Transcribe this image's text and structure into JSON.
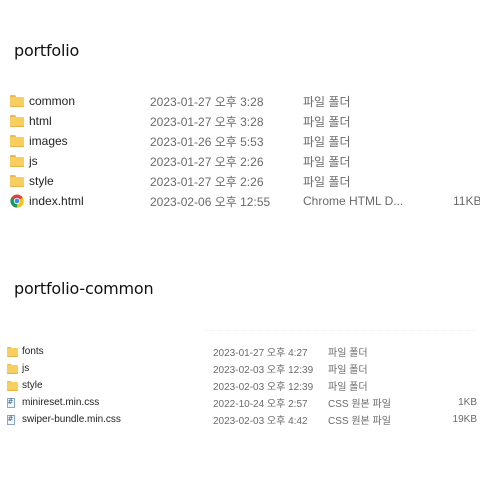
{
  "sections": [
    {
      "title": "portfolio",
      "rows": [
        {
          "icon": "folder-icon",
          "name": "common",
          "date": "2023-01-27 오후 3:28",
          "type": "파일 폴더",
          "size": ""
        },
        {
          "icon": "folder-icon",
          "name": "html",
          "date": "2023-01-27 오후 3:28",
          "type": "파일 폴더",
          "size": ""
        },
        {
          "icon": "folder-icon",
          "name": "images",
          "date": "2023-01-26 오후 5:53",
          "type": "파일 폴더",
          "size": ""
        },
        {
          "icon": "folder-icon",
          "name": "js",
          "date": "2023-01-27 오후 2:26",
          "type": "파일 폴더",
          "size": ""
        },
        {
          "icon": "folder-icon",
          "name": "style",
          "date": "2023-01-27 오후 2:26",
          "type": "파일 폴더",
          "size": ""
        },
        {
          "icon": "chrome-icon",
          "name": "index.html",
          "date": "2023-02-06 오후 12:55",
          "type": "Chrome HTML D...",
          "size": "11KB"
        }
      ]
    },
    {
      "title": "portfolio-common",
      "rows": [
        {
          "icon": "folder-icon",
          "name": "fonts",
          "date": "2023-01-27 오후 4:27",
          "type": "파일 폴더",
          "size": ""
        },
        {
          "icon": "folder-icon",
          "name": "js",
          "date": "2023-02-03 오후 12:39",
          "type": "파일 폴더",
          "size": ""
        },
        {
          "icon": "folder-icon",
          "name": "style",
          "date": "2023-02-03 오후 12:39",
          "type": "파일 폴더",
          "size": ""
        },
        {
          "icon": "css-file-icon",
          "name": "minireset.min.css",
          "date": "2022-10-24 오후 2:57",
          "type": "CSS 원본 파일",
          "size": "1KB"
        },
        {
          "icon": "css-file-icon",
          "name": "swiper-bundle.min.css",
          "date": "2023-02-03 오후 4:42",
          "type": "CSS 원본 파일",
          "size": "19KB"
        }
      ]
    }
  ],
  "colors": {
    "folder": "#f8cf5e",
    "text": "#222222",
    "meta": "#6a6a6a"
  }
}
